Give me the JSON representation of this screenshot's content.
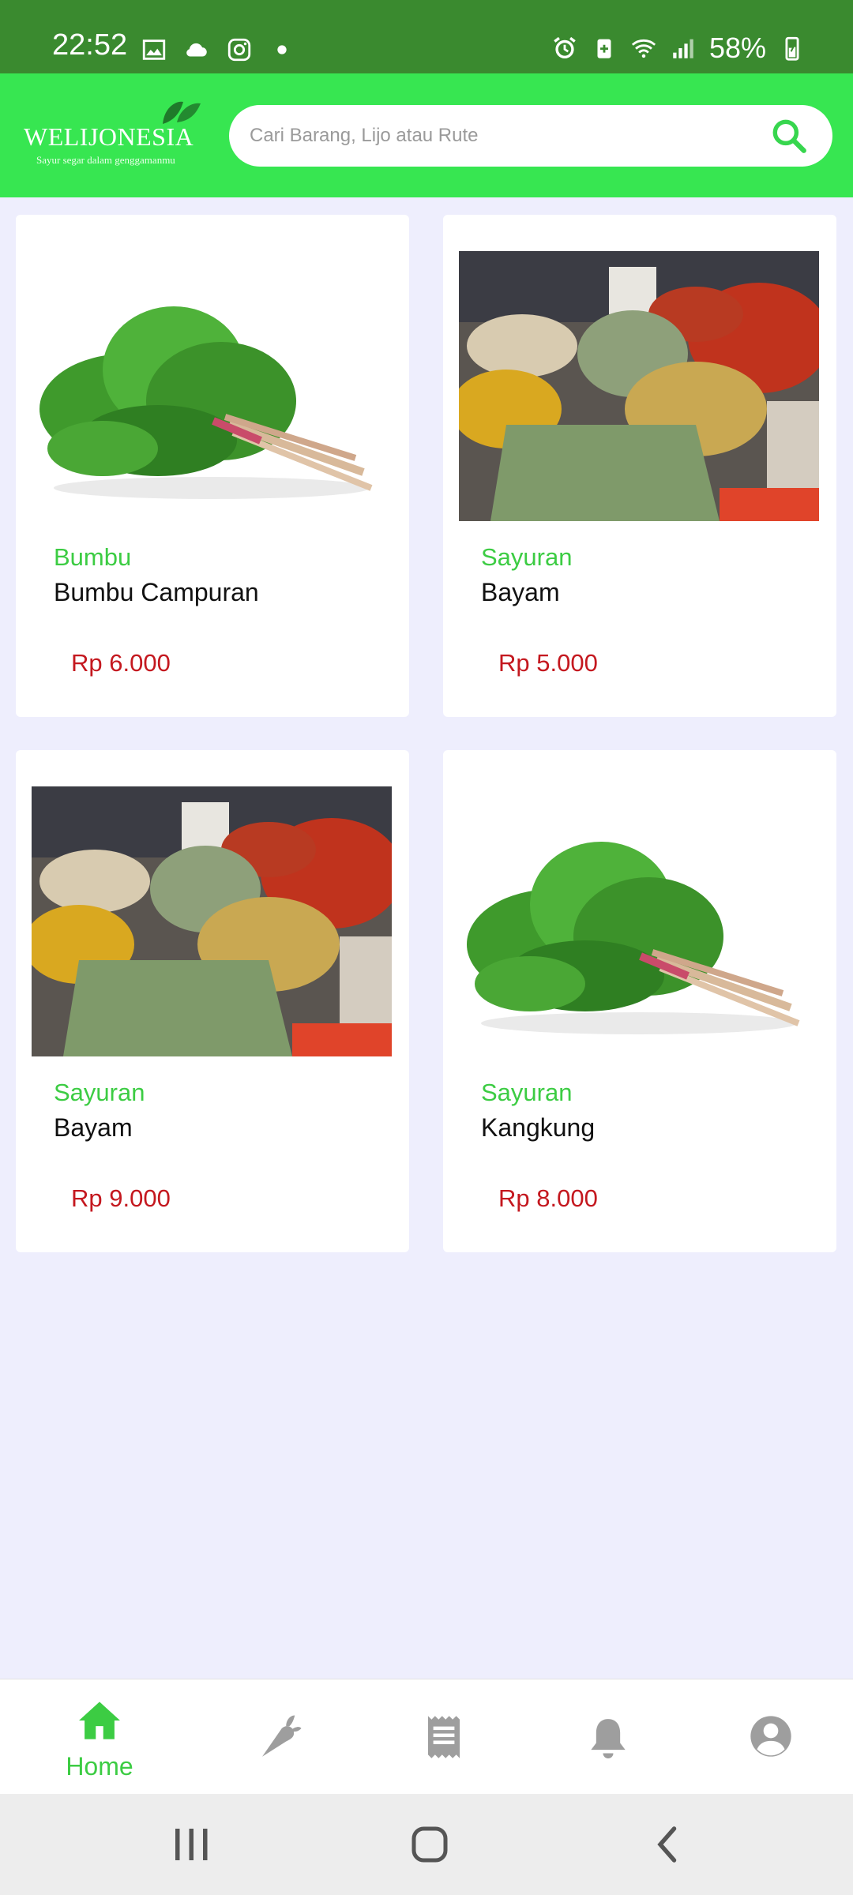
{
  "status_bar": {
    "time": "22:52",
    "battery": "58%"
  },
  "header": {
    "logo_text": "WELIJONESIA",
    "logo_subtitle": "Sayur segar dalam genggamanmu",
    "search_placeholder": "Cari Barang, Lijo atau Rute",
    "search_icon": "search-icon",
    "accent_color": "#37e651"
  },
  "products": [
    {
      "category": "Bumbu",
      "name": "Bumbu Campuran",
      "price": "Rp 6.000",
      "image": "spinach-image"
    },
    {
      "category": "Sayuran",
      "name": "Bayam",
      "price": "Rp 5.000",
      "image": "market-spices-image"
    },
    {
      "category": "Sayuran",
      "name": "Bayam",
      "price": "Rp 9.000",
      "image": "market-spices-image"
    },
    {
      "category": "Sayuran",
      "name": "Kangkung",
      "price": "Rp 8.000",
      "image": "spinach-image"
    }
  ],
  "bottom_nav": {
    "active": "Home",
    "items": [
      {
        "label": "Home",
        "icon": "home-icon"
      },
      {
        "label": "",
        "icon": "carrot-icon"
      },
      {
        "label": "",
        "icon": "receipt-icon"
      },
      {
        "label": "",
        "icon": "bell-icon"
      },
      {
        "label": "",
        "icon": "account-icon"
      }
    ]
  },
  "colors": {
    "category": "#3ccc43",
    "price": "#c4181f",
    "inactive_icon": "#9e9e9e"
  }
}
